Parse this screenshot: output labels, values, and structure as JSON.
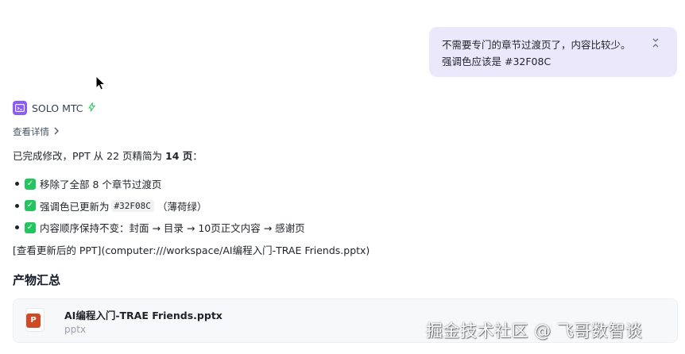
{
  "user_message": {
    "line1": "不需要专门的章节过渡页了，内容比较少。",
    "line2": "强调色应该是 #32F08C"
  },
  "agent": {
    "name": "SOLO MTC",
    "icon": "terminal-icon",
    "status_icon": "lightning-icon"
  },
  "details_link": {
    "label": "查看详情"
  },
  "summary": {
    "prefix": "已完成修改，PPT 从 22 页精简为 ",
    "bold": "14 页",
    "suffix": "："
  },
  "changes": [
    {
      "text": "移除了全部 8 个章节过渡页"
    },
    {
      "text_before": "强调色已更新为",
      "code": "#32F08C",
      "text_after": "（薄荷绿）"
    },
    {
      "text": "内容顺序保持不变：封面 → 目录 → 10页正文内容 → 感谢页"
    }
  ],
  "link_line": "[查看更新后的 PPT](computer:///workspace/AI编程入门-TRAE Friends.pptx)",
  "artifacts": {
    "title": "产物汇总",
    "file": {
      "name": "AI编程入门-TRAE Friends.pptx",
      "ext": "pptx",
      "icon_letter": "P"
    }
  },
  "watermark": "掘金技术社区 @ 飞哥数智谈",
  "colors": {
    "user_bubble": "#ebe8fc",
    "agent_icon": "#8b5cf6",
    "check": "#22c55e",
    "ppt_icon": "#d24726"
  }
}
